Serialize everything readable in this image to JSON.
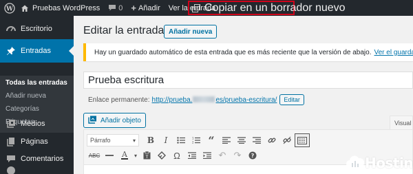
{
  "admin_bar": {
    "site_name": "Pruebas WordPress",
    "comments_count": "0",
    "new_label": "Añadir",
    "view_post_label": "Ver la entrada",
    "copy_draft_label": "Copiar en un borrador nuevo"
  },
  "sidebar": {
    "items": {
      "dashboard": "Escritorio",
      "posts": "Entradas",
      "media": "Medios",
      "pages": "Páginas",
      "comments": "Comentarios"
    },
    "submenu": {
      "all_posts": "Todas las entradas",
      "add_new": "Añadir nueva",
      "categories": "Categorías",
      "tags": "Etiquetas"
    }
  },
  "main": {
    "page_title": "Editar la entrada",
    "add_new_button": "Añadir nueva",
    "notice_text": "Hay un guardado automático de esta entrada que es más reciente que la versión de abajo.",
    "notice_link": "Ver el guardado automático",
    "post_title": "Prueba escritura",
    "permalink_label": "Enlace permanente:",
    "permalink_url_start": "http://prueba.",
    "permalink_url_mid": "es/",
    "permalink_slug": "prueba-escritura",
    "permalink_url_end": "/",
    "edit_button": "Editar",
    "add_media_button": "Añadir objeto",
    "visual_tab": "Visual"
  },
  "editor": {
    "format_select": "Párrafo",
    "toolbar_icons": [
      "bold-icon",
      "italic-icon",
      "unordered-list-icon",
      "ordered-list-icon",
      "blockquote-icon",
      "align-left-icon",
      "align-center-icon",
      "align-right-icon",
      "link-icon",
      "unlink-icon",
      "toolbar-toggle-icon"
    ],
    "toolbar2_icons": [
      "strikethrough-icon",
      "horizontal-line-icon",
      "text-color-icon",
      "paste-text-icon",
      "clear-formatting-icon",
      "special-character-icon",
      "outdent-icon",
      "indent-icon",
      "undo-icon",
      "redo-icon",
      "help-icon"
    ]
  },
  "watermark": {
    "text": "Hostinet"
  },
  "colors": {
    "admin_dark": "#23282d",
    "accent_blue": "#0073aa",
    "highlight_red": "#d0021b",
    "notice_warning": "#ffb900"
  }
}
